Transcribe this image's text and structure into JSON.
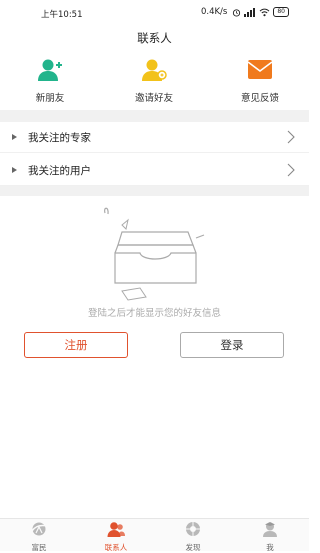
{
  "status_bar": {
    "time": "上午10:51",
    "speed": "0.4K/s",
    "battery": "80"
  },
  "title": "联系人",
  "quick_actions": [
    {
      "label": "新朋友",
      "icon": "add-person-icon",
      "color": "#22b48c"
    },
    {
      "label": "邀请好友",
      "icon": "invite-person-icon",
      "color": "#f2c21a"
    },
    {
      "label": "意见反馈",
      "icon": "mail-icon",
      "color": "#f07a1d"
    }
  ],
  "lists": [
    {
      "label": "我关注的专家"
    },
    {
      "label": "我关注的用户"
    }
  ],
  "empty": {
    "message": "登陆之后才能显示您的好友信息"
  },
  "buttons": {
    "register": "注册",
    "login": "登录"
  },
  "tabs": [
    {
      "label": "富民",
      "icon": "fumin-icon",
      "active": false
    },
    {
      "label": "联系人",
      "icon": "contacts-icon",
      "active": true
    },
    {
      "label": "发现",
      "icon": "discover-icon",
      "active": false
    },
    {
      "label": "我",
      "icon": "me-icon",
      "active": false
    }
  ],
  "colors": {
    "accent": "#e0522e",
    "muted": "#aaaaaa"
  }
}
